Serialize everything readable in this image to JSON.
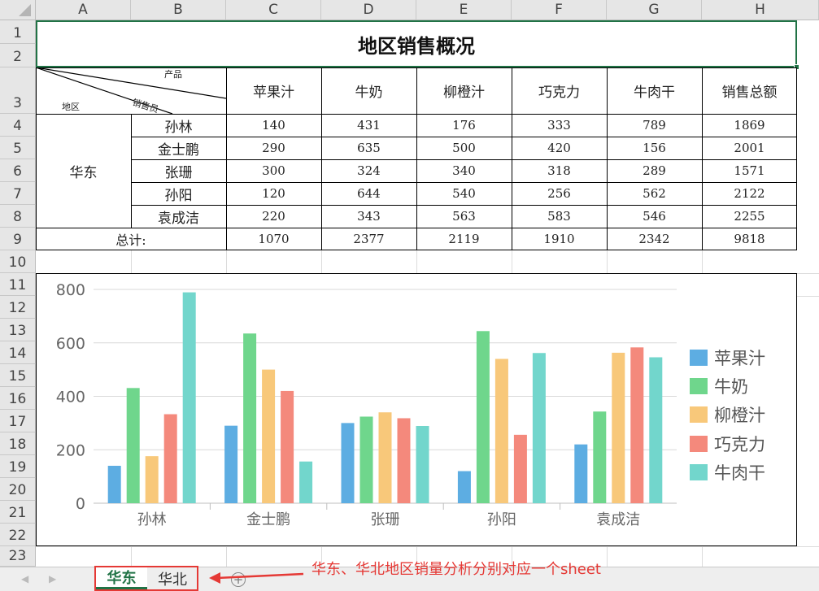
{
  "columns": [
    "A",
    "B",
    "C",
    "D",
    "E",
    "F",
    "G",
    "H"
  ],
  "rows": [
    "1",
    "2",
    "3",
    "4",
    "5",
    "6",
    "7",
    "8",
    "9",
    "10",
    "11",
    "12",
    "13",
    "14",
    "15",
    "16",
    "17",
    "18",
    "19",
    "20",
    "21",
    "22",
    "23"
  ],
  "sheet": {
    "title": "地区销售概况",
    "corner": {
      "product": "产品",
      "salesperson": "销售员",
      "region": "地区"
    },
    "product_headers": [
      "苹果汁",
      "牛奶",
      "柳橙汁",
      "巧克力",
      "牛肉干",
      "销售总额"
    ],
    "region": "华东",
    "people": [
      {
        "name": "孙林",
        "values": [
          "140",
          "431",
          "176",
          "333",
          "789",
          "1869"
        ]
      },
      {
        "name": "金士鹏",
        "values": [
          "290",
          "635",
          "500",
          "420",
          "156",
          "2001"
        ]
      },
      {
        "name": "张珊",
        "values": [
          "300",
          "324",
          "340",
          "318",
          "289",
          "1571"
        ]
      },
      {
        "name": "孙阳",
        "values": [
          "120",
          "644",
          "540",
          "256",
          "562",
          "2122"
        ]
      },
      {
        "name": "袁成洁",
        "values": [
          "220",
          "343",
          "563",
          "583",
          "546",
          "2255"
        ]
      }
    ],
    "total_label": "总计:",
    "totals": [
      "1070",
      "2377",
      "2119",
      "1910",
      "2342",
      "9818"
    ]
  },
  "chart_data": {
    "type": "bar",
    "categories": [
      "孙林",
      "金士鹏",
      "张珊",
      "孙阳",
      "袁成洁"
    ],
    "series": [
      {
        "name": "苹果汁",
        "values": [
          140,
          290,
          300,
          120,
          220
        ],
        "color": "#5dade2"
      },
      {
        "name": "牛奶",
        "values": [
          431,
          635,
          324,
          644,
          343
        ],
        "color": "#6fd68c"
      },
      {
        "name": "柳橙汁",
        "values": [
          176,
          500,
          340,
          540,
          563
        ],
        "color": "#f8c87a"
      },
      {
        "name": "巧克力",
        "values": [
          333,
          420,
          318,
          256,
          583
        ],
        "color": "#f4897c"
      },
      {
        "name": "牛肉干",
        "values": [
          789,
          156,
          289,
          562,
          546
        ],
        "color": "#72d6cc"
      }
    ],
    "ylim": [
      0,
      800
    ],
    "yticks": [
      0,
      200,
      400,
      600,
      800
    ],
    "legend": "right",
    "grid": true
  },
  "tabs": [
    "华东",
    "华北"
  ],
  "active_tab": "华东",
  "annotation": "华东、华北地区销量分析分别对应一个sheet",
  "colors": {
    "accent_green": "#217346",
    "annotation_red": "#e53935"
  }
}
